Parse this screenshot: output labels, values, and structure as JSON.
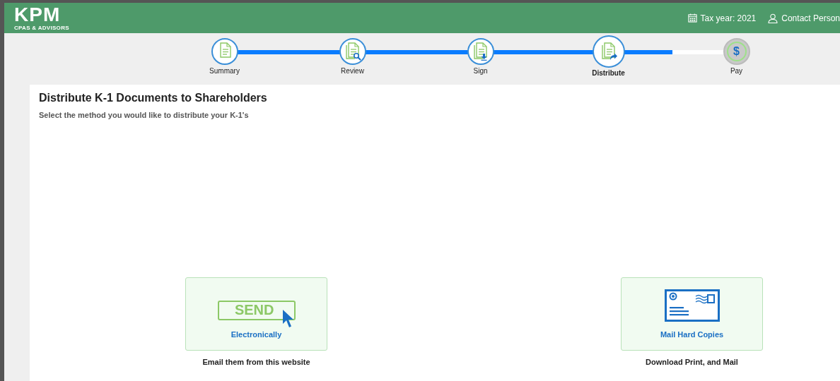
{
  "header": {
    "logo": "KPM",
    "logo_subtitle": "CPAS & ADVISORS",
    "tax_year": "Tax year: 2021",
    "contact": "Contact Person"
  },
  "steps": [
    {
      "label": "Summary",
      "kind": "summary",
      "completed": true,
      "selected": false
    },
    {
      "label": "Review",
      "kind": "review",
      "completed": true,
      "selected": false
    },
    {
      "label": "Sign",
      "kind": "sign",
      "completed": true,
      "selected": false
    },
    {
      "label": "Distribute",
      "kind": "distribute",
      "completed": false,
      "selected": true
    },
    {
      "label": "Pay",
      "kind": "pay",
      "completed": false,
      "selected": false,
      "icon_text": "$"
    }
  ],
  "page": {
    "title": "Distribute K-1 Documents to Shareholders",
    "subtitle": "Select the method you would like to distribute your K-1's"
  },
  "options": [
    {
      "kind": "send",
      "icon_text": "SEND",
      "label": "Electronically",
      "caption": "Email them from this website"
    },
    {
      "kind": "mail",
      "label": "Mail Hard Copies",
      "caption": "Download Print, and Mail"
    }
  ]
}
